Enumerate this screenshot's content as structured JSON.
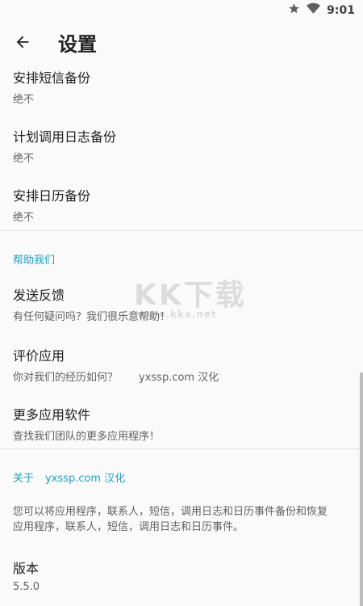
{
  "status": {
    "time": "9:01"
  },
  "toolbar": {
    "title": "设置"
  },
  "prefs": {
    "sms": {
      "title": "安排短信备份",
      "summary": "绝不"
    },
    "calllog": {
      "title": "计划调用日志备份",
      "summary": "绝不"
    },
    "calendar": {
      "title": "安排日历备份",
      "summary": "绝不"
    },
    "help_header": "帮助我们",
    "feedback": {
      "title": "发送反馈",
      "summary": "有任何疑问吗？我们很乐意帮助！"
    },
    "rate": {
      "title": "评价应用",
      "summary": "你对我们的经历如何？",
      "note": "yxssp.com 汉化"
    },
    "more": {
      "title": "更多应用软件",
      "summary": "查找我们团队的更多应用程序！"
    },
    "about_header": "关于",
    "about_note": "yxssp.com 汉化",
    "about_desc": "您可以将应用程序，联系人，短信，调用日志和日历事件备份和恢复应用程序，联系人，短信，调用日志和日历事件。",
    "version": {
      "title": "版本",
      "summary": "5.5.0"
    }
  },
  "watermark": {
    "brand": "KK下载",
    "site": "www.kkx.net"
  },
  "icons": {
    "star": "star-icon",
    "wifi": "wifi-icon",
    "back": "arrow-back-icon"
  },
  "colors": {
    "accent": "#1aa3c8"
  }
}
